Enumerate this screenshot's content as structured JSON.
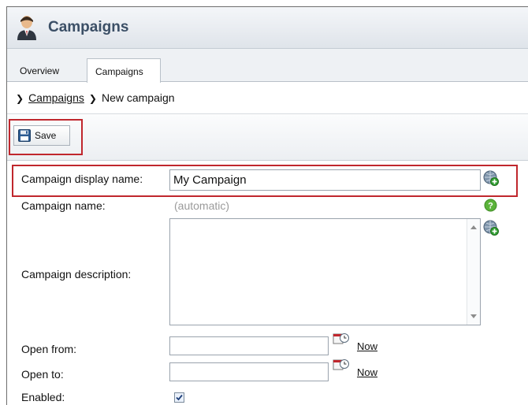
{
  "header": {
    "title": "Campaigns",
    "icon": "user-icon"
  },
  "tabs": [
    {
      "label": "Overview",
      "active": false
    },
    {
      "label": "Campaigns",
      "active": true
    }
  ],
  "breadcrumb": {
    "parent": "Campaigns",
    "current": "New campaign"
  },
  "toolbar": {
    "save_label": "Save",
    "save_icon": "floppy-disk-icon"
  },
  "form": {
    "display_name": {
      "label": "Campaign display name:",
      "value": "My Campaign"
    },
    "name": {
      "label": "Campaign name:",
      "value": "(automatic)"
    },
    "description": {
      "label": "Campaign description:",
      "value": ""
    },
    "open_from": {
      "label": "Open from:",
      "value": "",
      "now_label": "Now"
    },
    "open_to": {
      "label": "Open to:",
      "value": "",
      "now_label": "Now"
    },
    "enabled": {
      "label": "Enabled:",
      "checked": true
    }
  },
  "colors": {
    "highlight": "#c0272d",
    "header_title": "#3b4f66"
  }
}
